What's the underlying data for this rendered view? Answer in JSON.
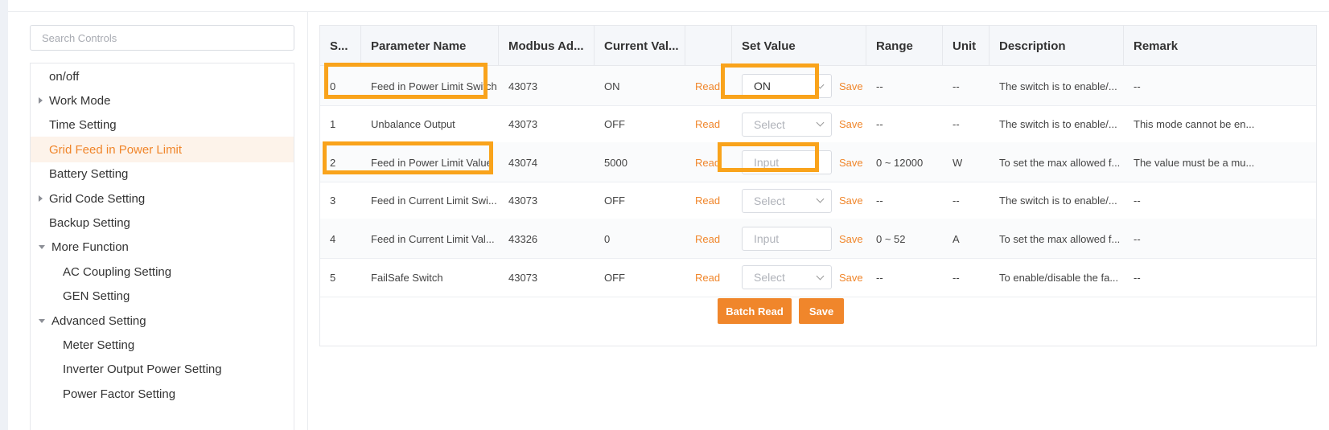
{
  "search": {
    "placeholder": "Search Controls"
  },
  "sidebar": {
    "items": [
      {
        "label": "on/off",
        "caret": "",
        "indent": 0,
        "active": false
      },
      {
        "label": "Work Mode",
        "caret": "right",
        "indent": 0,
        "active": false
      },
      {
        "label": "Time Setting",
        "caret": "",
        "indent": 0,
        "active": false
      },
      {
        "label": "Grid Feed in Power Limit",
        "caret": "",
        "indent": 0,
        "active": true
      },
      {
        "label": "Battery Setting",
        "caret": "",
        "indent": 0,
        "active": false
      },
      {
        "label": "Grid Code Setting",
        "caret": "right",
        "indent": 0,
        "active": false
      },
      {
        "label": "Backup Setting",
        "caret": "",
        "indent": 0,
        "active": false
      },
      {
        "label": "More Function",
        "caret": "down",
        "indent": 0,
        "active": false
      },
      {
        "label": "AC Coupling Setting",
        "caret": "",
        "indent": 1,
        "active": false
      },
      {
        "label": "GEN Setting",
        "caret": "",
        "indent": 1,
        "active": false
      },
      {
        "label": "Advanced Setting",
        "caret": "down",
        "indent": 0,
        "active": false
      },
      {
        "label": "Meter Setting",
        "caret": "",
        "indent": 1,
        "active": false
      },
      {
        "label": "Inverter Output Power Setting",
        "caret": "",
        "indent": 1,
        "active": false
      },
      {
        "label": "Power Factor Setting",
        "caret": "",
        "indent": 1,
        "active": false
      }
    ]
  },
  "table": {
    "columns": [
      "S...",
      "Parameter Name",
      "Modbus Ad...",
      "Current Val...",
      "",
      "Set Value",
      "Range",
      "Unit",
      "Description",
      "Remark"
    ],
    "read_label": "Read",
    "save_label": "Save",
    "rows": [
      {
        "seq": "0",
        "name": "Feed in Power Limit Switch",
        "modbus": "43073",
        "current": "ON",
        "control": "select",
        "set_value": "ON",
        "range": "--",
        "unit": "--",
        "description": "The switch is to enable/...",
        "remark": "--"
      },
      {
        "seq": "1",
        "name": "Unbalance Output",
        "modbus": "43073",
        "current": "OFF",
        "control": "select",
        "set_value": "Select",
        "range": "--",
        "unit": "--",
        "description": "The switch is to enable/...",
        "remark": "This mode cannot be en..."
      },
      {
        "seq": "2",
        "name": "Feed in Power Limit Value",
        "modbus": "43074",
        "current": "5000",
        "control": "input",
        "set_value": "Input",
        "range": "0 ~ 12000",
        "unit": "W",
        "description": "To set the max allowed f...",
        "remark": "The value must be a mu..."
      },
      {
        "seq": "3",
        "name": "Feed in Current Limit Swi...",
        "modbus": "43073",
        "current": "OFF",
        "control": "select",
        "set_value": "Select",
        "range": "--",
        "unit": "--",
        "description": "The switch is to enable/...",
        "remark": "--"
      },
      {
        "seq": "4",
        "name": "Feed in Current Limit Val...",
        "modbus": "43326",
        "current": "0",
        "control": "input",
        "set_value": "Input",
        "range": "0 ~ 52",
        "unit": "A",
        "description": "To set the max allowed f...",
        "remark": "--"
      },
      {
        "seq": "5",
        "name": "FailSafe Switch",
        "modbus": "43073",
        "current": "OFF",
        "control": "select",
        "set_value": "Select",
        "range": "--",
        "unit": "--",
        "description": "To enable/disable the fa...",
        "remark": "--"
      }
    ]
  },
  "actions": {
    "batch_read": "Batch Read",
    "save": "Save"
  },
  "colors": {
    "accent": "#f0862b",
    "highlight": "#f9a31b"
  }
}
